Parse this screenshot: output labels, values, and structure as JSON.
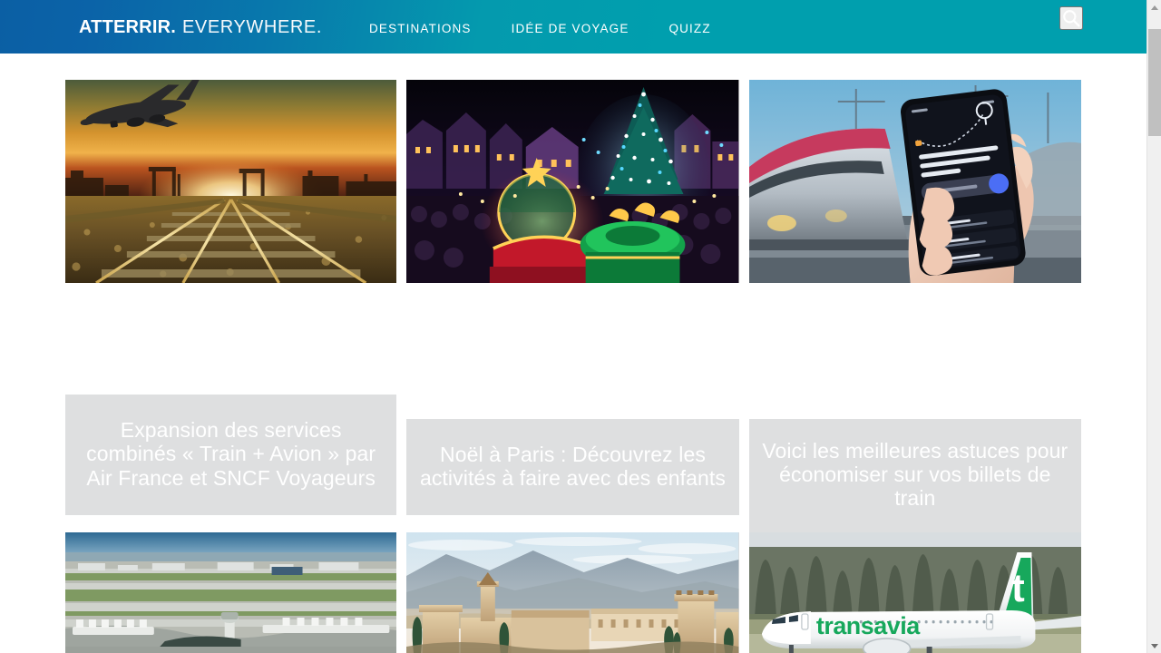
{
  "header": {
    "brand_strong": "ATTERRIR.",
    "brand_light": "EVERYWHERE.",
    "nav": [
      {
        "label": "DESTINATIONS",
        "name": "nav-destinations"
      },
      {
        "label": "IDÉE DE VOYAGE",
        "name": "nav-idee-de-voyage"
      },
      {
        "label": "QUIZZ",
        "name": "nav-quizz"
      }
    ],
    "search_icon": "search-icon",
    "gradient_start": "#0b5fa4",
    "gradient_end": "#009fae"
  },
  "cards": {
    "row1": [
      {
        "image_alt": "Avion de ligne survolant des rails de chemin de fer au coucher du soleil",
        "image_name": "thumb-train-avion-sunset",
        "title": "Expansion des services combinés « Train + Avion » par Air France et SNCF Voyageurs"
      },
      {
        "image_alt": "Parade de Noël illuminée à Disneyland Paris la nuit",
        "image_name": "thumb-noel-paris-parade",
        "title": "Noël à Paris : Découvrez les activités à faire avec des enfants"
      },
      {
        "image_alt": "Main tenant un smartphone affichant une application de voyage devant un TGV",
        "image_name": "thumb-app-billets-train",
        "title": "Voici les meilleures astuces pour économiser sur vos billets de train"
      }
    ],
    "row2": [
      {
        "image_alt": "Vue aérienne d'un grand aéroport avec sa tour de contrôle",
        "image_name": "thumb-aeroport-aerien"
      },
      {
        "image_alt": "L'Alhambra de Grenade au coucher du soleil avec la Sierra Nevada",
        "image_name": "thumb-alhambra-grenade"
      },
      {
        "image_alt": "Avion Transavia Boeing 737 sur la piste",
        "image_name": "thumb-transavia-avion"
      }
    ]
  },
  "scrollbar": {
    "up_arrow": "scroll-up-arrow",
    "down_arrow": "scroll-down-arrow",
    "thumb": "scroll-thumb"
  },
  "colors": {
    "title_block_bg": "#dedfe0",
    "title_text": "#ffffff",
    "page_bg": "#ffffff"
  }
}
